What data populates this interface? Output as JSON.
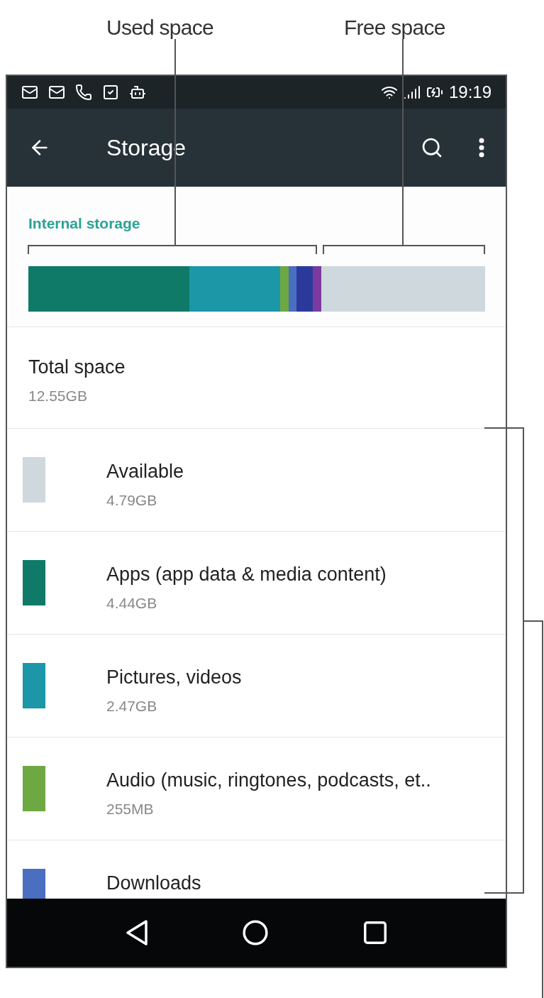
{
  "annotations": [
    {
      "text": "Used space"
    },
    {
      "text": "Free space"
    }
  ],
  "status_bar": {
    "time": "19:19"
  },
  "toolbar": {
    "title": "Storage"
  },
  "storage": {
    "title": "Internal storage",
    "segments": [
      {
        "color": "#0f7a68"
      },
      {
        "color": "#1b97a8"
      },
      {
        "color": "#6ea843"
      },
      {
        "color": "#4a6fc0"
      },
      {
        "color": "#2b3a9a"
      },
      {
        "color": "#7b3aa0"
      },
      {
        "color": "#cfd8dc"
      }
    ]
  },
  "total": {
    "label": "Total space",
    "value": "12.55GB"
  },
  "categories": [
    {
      "name": "Available",
      "size": "4.79GB",
      "color": "#cfd8dc"
    },
    {
      "name": "Apps (app data & media content)",
      "size": "4.44GB",
      "color": "#0f7a68"
    },
    {
      "name": "Pictures, videos",
      "size": "2.47GB",
      "color": "#1b97a8"
    },
    {
      "name": "Audio (music, ringtones, podcasts, et..",
      "size": "255MB",
      "color": "#6ea843"
    },
    {
      "name": "Downloads",
      "color": "#4a6fc0"
    }
  ]
}
